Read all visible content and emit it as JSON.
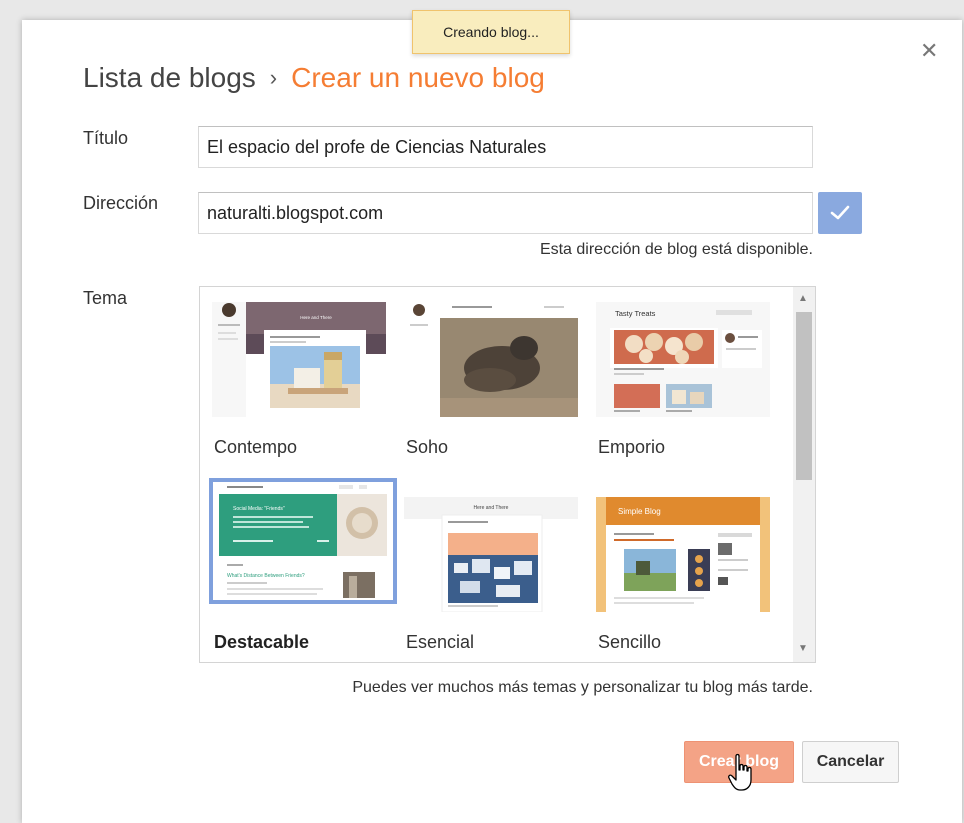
{
  "toast": {
    "text": "Creando blog..."
  },
  "breadcrumb": {
    "root": "Lista de blogs",
    "separator": "›",
    "current": "Crear un nuevo blog"
  },
  "title_field": {
    "label": "Título",
    "value": "El espacio del profe de Ciencias Naturales"
  },
  "address_field": {
    "label": "Dirección",
    "value": "naturalti.blogspot.com",
    "availability": "Esta dirección de blog está disponible."
  },
  "theme": {
    "label": "Tema",
    "options": [
      {
        "name": "Contempo",
        "selected": false
      },
      {
        "name": "Soho",
        "selected": false
      },
      {
        "name": "Emporio",
        "selected": false
      },
      {
        "name": "Destacable",
        "selected": true
      },
      {
        "name": "Esencial",
        "selected": false
      },
      {
        "name": "Sencillo",
        "selected": false
      }
    ],
    "thumb_text": {
      "contempo": "Here and There",
      "emporio": "Tasty Treats",
      "destacable_header": "Social Media: \"Friends\"",
      "destacable_post": "What's Distance Between Friends?",
      "esencial": "Here and There",
      "sencillo": "Simple Blog"
    },
    "hint": "Puedes ver muchos más temas y personalizar tu blog más tarde."
  },
  "actions": {
    "create": "Crear blog",
    "cancel": "Cancelar"
  },
  "colors": {
    "accent": "#f57d33",
    "selection": "#7fa0dd",
    "check": "#8aa9df",
    "create_btn": "#f4a386",
    "toast": "#f9edbe"
  }
}
